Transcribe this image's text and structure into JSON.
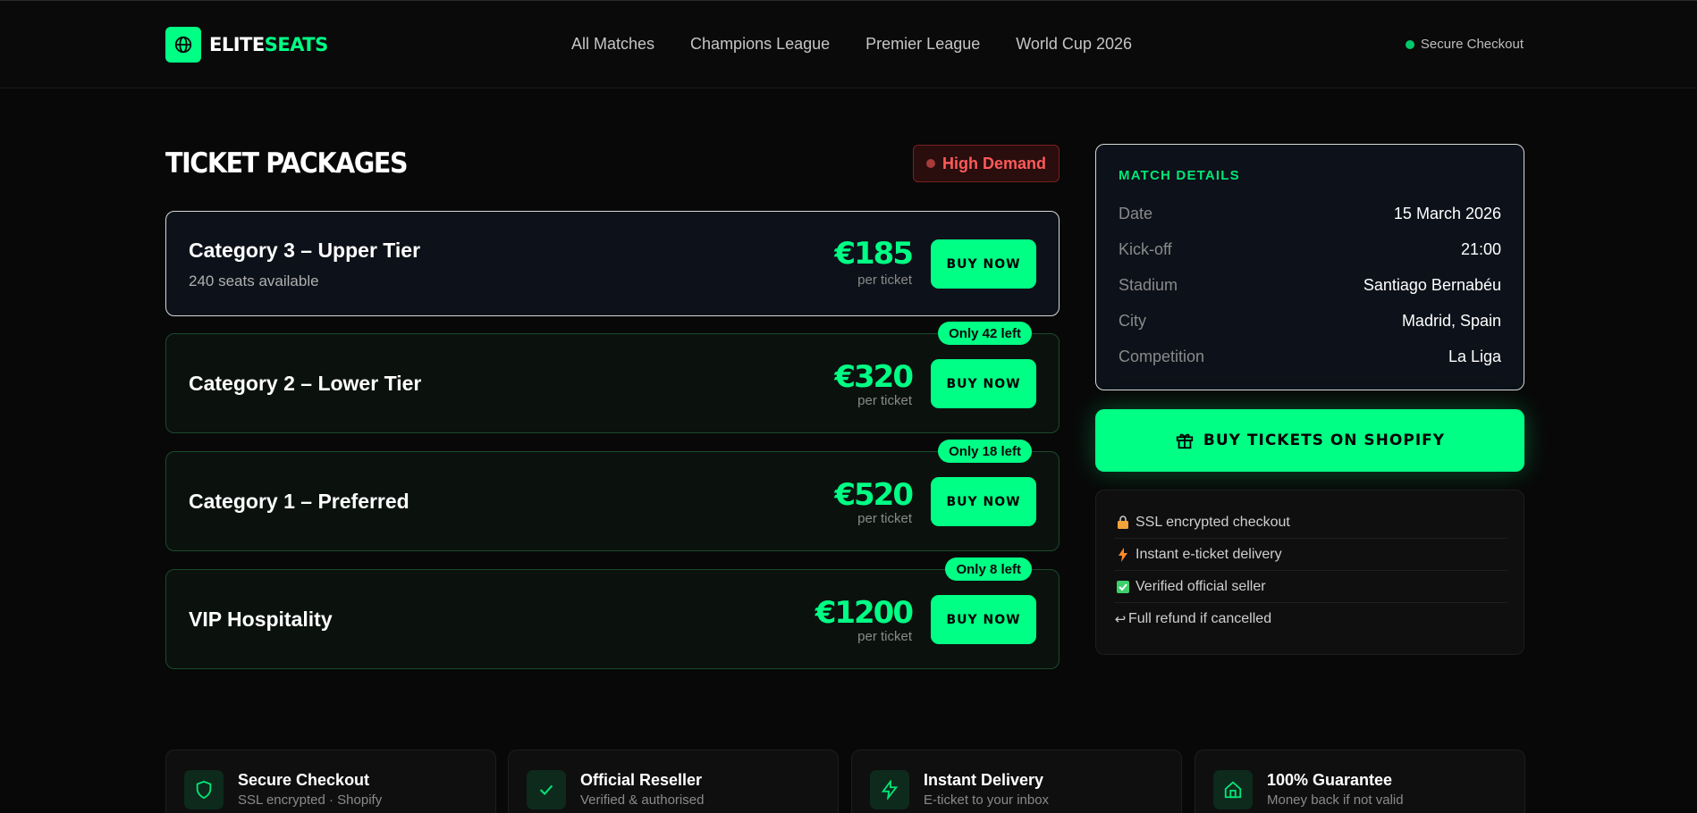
{
  "brand": {
    "part1": "ELITE",
    "part2": "SEATS",
    "icon": "globe-icon"
  },
  "nav": [
    {
      "label": "All Matches"
    },
    {
      "label": "Champions League"
    },
    {
      "label": "Premier League"
    },
    {
      "label": "World Cup 2026"
    }
  ],
  "header": {
    "secure": "Secure Checkout"
  },
  "packages_section": {
    "title": "TICKET PACKAGES",
    "demand_badge": "High Demand",
    "items": [
      {
        "name": "Category 3 – Upper Tier",
        "availability": "240 seats available",
        "price": "€185",
        "per": "per ticket",
        "buy": "BUY NOW",
        "badge": ""
      },
      {
        "name": "Category 2 – Lower Tier",
        "availability": "",
        "price": "€320",
        "per": "per ticket",
        "buy": "BUY NOW",
        "badge": "Only 42 left"
      },
      {
        "name": "Category 1 – Preferred",
        "availability": "",
        "price": "€520",
        "per": "per ticket",
        "buy": "BUY NOW",
        "badge": "Only 18 left"
      },
      {
        "name": "VIP Hospitality",
        "availability": "",
        "price": "€1200",
        "per": "per ticket",
        "buy": "BUY NOW",
        "badge": "Only 8 left"
      }
    ]
  },
  "match_details": {
    "title": "MATCH DETAILS",
    "rows": [
      {
        "key": "Date",
        "value": "15 March 2026"
      },
      {
        "key": "Kick-off",
        "value": "21:00"
      },
      {
        "key": "Stadium",
        "value": "Santiago Bernabéu"
      },
      {
        "key": "City",
        "value": "Madrid, Spain"
      },
      {
        "key": "Competition",
        "value": "La Liga"
      }
    ]
  },
  "shopify_button": {
    "label": "BUY TICKETS ON SHOPIFY",
    "icon": "gift-icon"
  },
  "features": [
    {
      "icon": "lock-icon",
      "label": "SSL encrypted checkout"
    },
    {
      "icon": "lightning-icon",
      "label": "Instant e-ticket delivery"
    },
    {
      "icon": "checkbox-icon",
      "label": "Verified official seller"
    },
    {
      "icon": "return-arrow-icon",
      "label": "Full refund if cancelled"
    }
  ],
  "trust_cards": [
    {
      "icon": "shield-icon",
      "title": "Secure Checkout",
      "subtitle": "SSL encrypted · Shopify"
    },
    {
      "icon": "check-icon",
      "title": "Official Reseller",
      "subtitle": "Verified & authorised"
    },
    {
      "icon": "lightning-icon",
      "title": "Instant Delivery",
      "subtitle": "E-ticket to your inbox"
    },
    {
      "icon": "home-icon",
      "title": "100% Guarantee",
      "subtitle": "Money back if not valid"
    }
  ],
  "colors": {
    "accent": "#00ff85",
    "background": "#080808",
    "danger": "#ff5a5a",
    "card": "#0d1119"
  }
}
